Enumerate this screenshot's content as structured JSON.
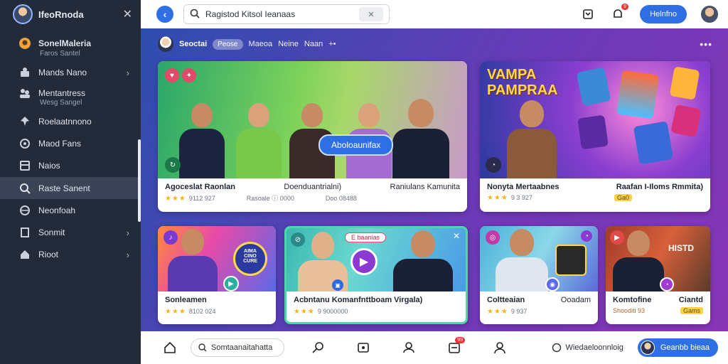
{
  "sidebar": {
    "title": "IfeoRnoda",
    "items": [
      {
        "label": "SonelMaleria",
        "sub": "Faros Santel",
        "icon": "user-icon"
      },
      {
        "label": "Mands Nano",
        "icon": "users-icon",
        "chevron": true
      },
      {
        "label": "Mentantress",
        "sub": "Wesg Sangel",
        "icon": "people-icon"
      },
      {
        "label": "Roelaatnnono",
        "icon": "pin-icon"
      },
      {
        "label": "Maod Fans",
        "icon": "star-icon"
      },
      {
        "label": "Naios",
        "icon": "grid-icon"
      },
      {
        "label": "Raste Sanent",
        "icon": "search-icon",
        "active": true
      },
      {
        "label": "Neonfoah",
        "icon": "globe-icon"
      },
      {
        "label": "Sonmit",
        "icon": "doc-icon",
        "chevron": true
      },
      {
        "label": "Rioot",
        "icon": "home-icon",
        "chevron": true
      }
    ]
  },
  "topbar": {
    "search_value": "Ragistod Kitsol Ieanaas",
    "primary_button": "Helnfno",
    "notif_badge": "9"
  },
  "channel": {
    "name": "Seoctai",
    "pill": "Peose",
    "tabs": [
      "Maeoa",
      "Neine",
      "Naan"
    ],
    "suffix": "+•"
  },
  "cards": [
    {
      "title": "Agoceslat Raonlan",
      "subtitle": "Doenduantrialni)",
      "subtitle2": "Raniulans Kamunita",
      "stars": "★★★",
      "meta": "9112 927",
      "meta2": "Rasoale ⓘ 0000",
      "meta3": "Doo 08488",
      "overlay_button": "Aboloaunifax"
    },
    {
      "title": "Nonyta Mertaabnes",
      "title_right": "Raafan I-Iloms Rmmita)",
      "stars": "★★★",
      "meta": "9 3 927",
      "chip": "Ga0",
      "banner": "VAMPA PAMPRAA"
    },
    {
      "title": "Sonleamen",
      "stars": "★★★",
      "meta": "8102 024",
      "thumb_text": "AIMA CINO CURE"
    },
    {
      "title": "Acbntanu Komanfnttboam Virgala)",
      "stars": "★★★",
      "meta": "9 9000000",
      "tag": "E baanias"
    },
    {
      "title": "Coltteaian",
      "title_right": "Ooadam",
      "stars": "★★★",
      "meta": "9 937"
    },
    {
      "title": "Komtofine",
      "title_right": "Ciantd",
      "meta": "Shooditi 93",
      "chip": "Gams",
      "thumb_text": "HISTD"
    }
  ],
  "bottombar": {
    "search_value": "Somtaanaitahatta",
    "link_label": "Wiedaeloonnloig",
    "cta_label": "Geanbb bieaa",
    "badge": "99"
  },
  "colors": {
    "accent": "#2f6fe4",
    "star": "#f3b51b",
    "sidebar_bg": "#232b3b"
  }
}
